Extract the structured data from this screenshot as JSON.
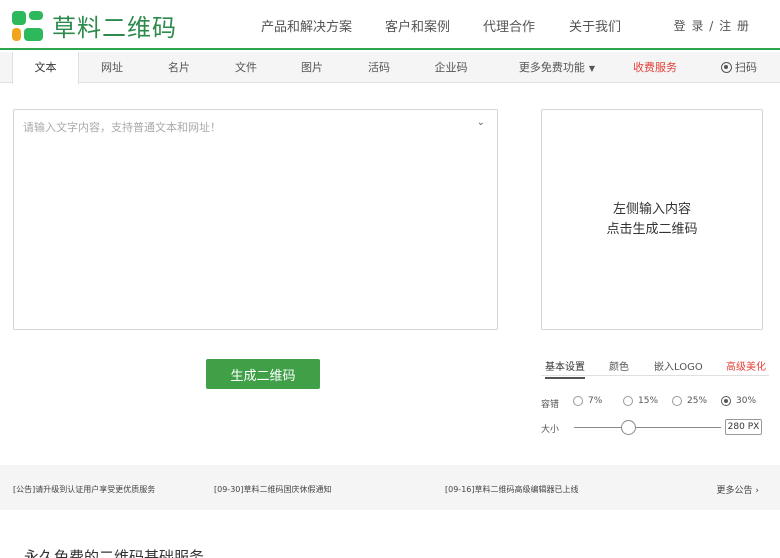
{
  "brand": {
    "name": "草料二维码"
  },
  "top_nav": [
    "产品和解决方案",
    "客户和案例",
    "代理合作",
    "关于我们"
  ],
  "auth": {
    "login": "登 录",
    "sep": "/",
    "register": "注 册"
  },
  "tabs": [
    {
      "label": "文本",
      "active": true
    },
    {
      "label": "网址"
    },
    {
      "label": "名片"
    },
    {
      "label": "文件"
    },
    {
      "label": "图片"
    },
    {
      "label": "活码"
    },
    {
      "label": "企业码"
    },
    {
      "label": "更多免费功能"
    },
    {
      "label": "收费服务"
    },
    {
      "label": "扫码"
    }
  ],
  "input": {
    "placeholder": "请输入文字内容，支持普通文本和网址！",
    "value": ""
  },
  "generate_button": "生成二维码",
  "preview": {
    "line1": "左侧输入内容",
    "line2": "点击生成二维码"
  },
  "settings": {
    "tabs": [
      "基本设置",
      "颜色",
      "嵌入LOGO",
      "高级美化"
    ],
    "error_correction": {
      "label": "容错",
      "options": [
        "7%",
        "15%",
        "25%",
        "30%"
      ],
      "selected": "30%"
    },
    "size": {
      "label": "大小",
      "value": "280 PX",
      "level": 0.37
    }
  },
  "notices": [
    "[公告]请升级到认证用户享受更优质服务",
    "[09-30]草料二维码国庆休假通知",
    "[09-16]草料二维码高级编辑器已上线"
  ],
  "more_notices": "更多公告",
  "section_title": "永久免费的二维码基础服务",
  "colors": {
    "brand_green": "#2eb85c",
    "button_green": "#3fa048",
    "accent_red": "#e5413a",
    "logo_orange": "#f0a51a"
  }
}
